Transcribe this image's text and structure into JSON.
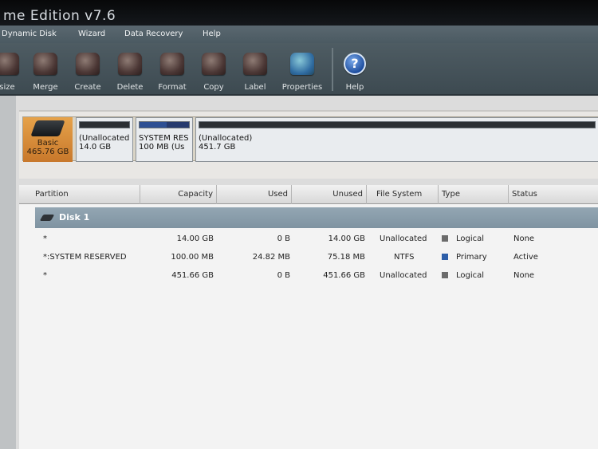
{
  "window": {
    "title": "me Edition v7.6"
  },
  "menu": [
    "Dynamic Disk",
    "Wizard",
    "Data Recovery",
    "Help"
  ],
  "toolbar": [
    {
      "label": "size",
      "icon": "resize-icon"
    },
    {
      "label": "Merge",
      "icon": "merge-icon"
    },
    {
      "label": "Create",
      "icon": "create-icon"
    },
    {
      "label": "Delete",
      "icon": "delete-icon"
    },
    {
      "label": "Format",
      "icon": "format-icon"
    },
    {
      "label": "Copy",
      "icon": "copy-icon"
    },
    {
      "label": "Label",
      "icon": "label-icon"
    },
    {
      "label": "Properties",
      "icon": "properties-icon"
    },
    {
      "label": "Help",
      "icon": "help-icon",
      "glyph": "?"
    }
  ],
  "diskmap": {
    "disk": {
      "type": "Basic",
      "size": "465.76 GB"
    },
    "partitions": [
      {
        "name": "(Unallocated",
        "size": "14.0 GB"
      },
      {
        "name": "SYSTEM RES",
        "size": "100 MB (Us"
      },
      {
        "name": "(Unallocated)",
        "size": "451.7 GB"
      }
    ]
  },
  "table": {
    "columns": [
      "Partition",
      "Capacity",
      "Used",
      "Unused",
      "File System",
      "Type",
      "Status"
    ],
    "disk_label": "Disk 1",
    "rows": [
      {
        "partition": "*",
        "capacity": "14.00 GB",
        "used": "0 B",
        "unused": "14.00 GB",
        "fs": "Unallocated",
        "type": "Logical",
        "status": "None"
      },
      {
        "partition": "*:SYSTEM RESERVED",
        "capacity": "100.00 MB",
        "used": "24.82 MB",
        "unused": "75.18 MB",
        "fs": "NTFS",
        "type": "Primary",
        "status": "Active"
      },
      {
        "partition": "*",
        "capacity": "451.66 GB",
        "used": "0 B",
        "unused": "451.66 GB",
        "fs": "Unallocated",
        "type": "Logical",
        "status": "None"
      }
    ]
  },
  "colors": {
    "logical": "#6b6b6b",
    "primary": "#2d5ea8"
  }
}
